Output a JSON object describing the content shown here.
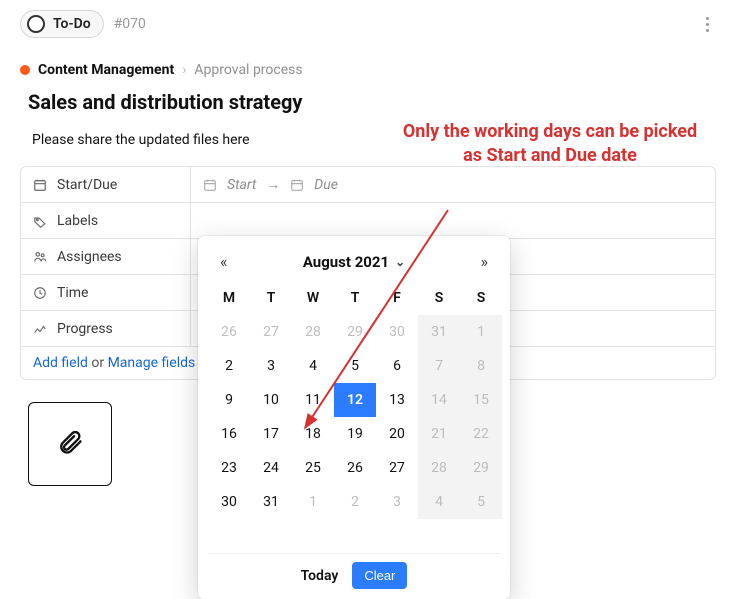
{
  "header": {
    "status_label": "To-Do",
    "issue_number": "#070"
  },
  "breadcrumb": {
    "project": "Content Management",
    "separator": "›",
    "state": "Approval process"
  },
  "title": "Sales and distribution strategy",
  "description": "Please share the updated files here",
  "fields": {
    "startdue_label": "Start/Due",
    "start_placeholder": "Start",
    "due_placeholder": "Due",
    "labels_label": "Labels",
    "assignees_label": "Assignees",
    "time_label": "Time",
    "progress_label": "Progress"
  },
  "addfield": {
    "add_text": "Add field",
    "or_text": " or ",
    "manage_text": "Manage fields"
  },
  "datepicker": {
    "month_label": "August 2021",
    "weekdays": [
      "M",
      "T",
      "W",
      "T",
      "F",
      "S",
      "S"
    ],
    "today_label": "Today",
    "clear_label": "Clear",
    "rows": [
      [
        {
          "d": 26,
          "out": true
        },
        {
          "d": 27,
          "out": true
        },
        {
          "d": 28,
          "out": true
        },
        {
          "d": 29,
          "out": true
        },
        {
          "d": 30,
          "out": true
        },
        {
          "d": 31,
          "wknd": true,
          "out": true
        },
        {
          "d": 1,
          "wknd": true
        }
      ],
      [
        {
          "d": 2
        },
        {
          "d": 3
        },
        {
          "d": 4
        },
        {
          "d": 5
        },
        {
          "d": 6
        },
        {
          "d": 7,
          "wknd": true
        },
        {
          "d": 8,
          "wknd": true
        }
      ],
      [
        {
          "d": 9
        },
        {
          "d": 10
        },
        {
          "d": 11
        },
        {
          "d": 12,
          "sel": true
        },
        {
          "d": 13
        },
        {
          "d": 14,
          "wknd": true
        },
        {
          "d": 15,
          "wknd": true
        }
      ],
      [
        {
          "d": 16
        },
        {
          "d": 17
        },
        {
          "d": 18
        },
        {
          "d": 19
        },
        {
          "d": 20
        },
        {
          "d": 21,
          "wknd": true
        },
        {
          "d": 22,
          "wknd": true
        }
      ],
      [
        {
          "d": 23
        },
        {
          "d": 24
        },
        {
          "d": 25
        },
        {
          "d": 26
        },
        {
          "d": 27
        },
        {
          "d": 28,
          "wknd": true
        },
        {
          "d": 29,
          "wknd": true
        }
      ],
      [
        {
          "d": 30
        },
        {
          "d": 31
        },
        {
          "d": 1,
          "out": true
        },
        {
          "d": 2,
          "out": true
        },
        {
          "d": 3,
          "out": true
        },
        {
          "d": 4,
          "wknd": true,
          "out": true
        },
        {
          "d": 5,
          "wknd": true,
          "out": true
        }
      ]
    ]
  },
  "annotation": "Only the working  days can be picked as Start and Due date"
}
